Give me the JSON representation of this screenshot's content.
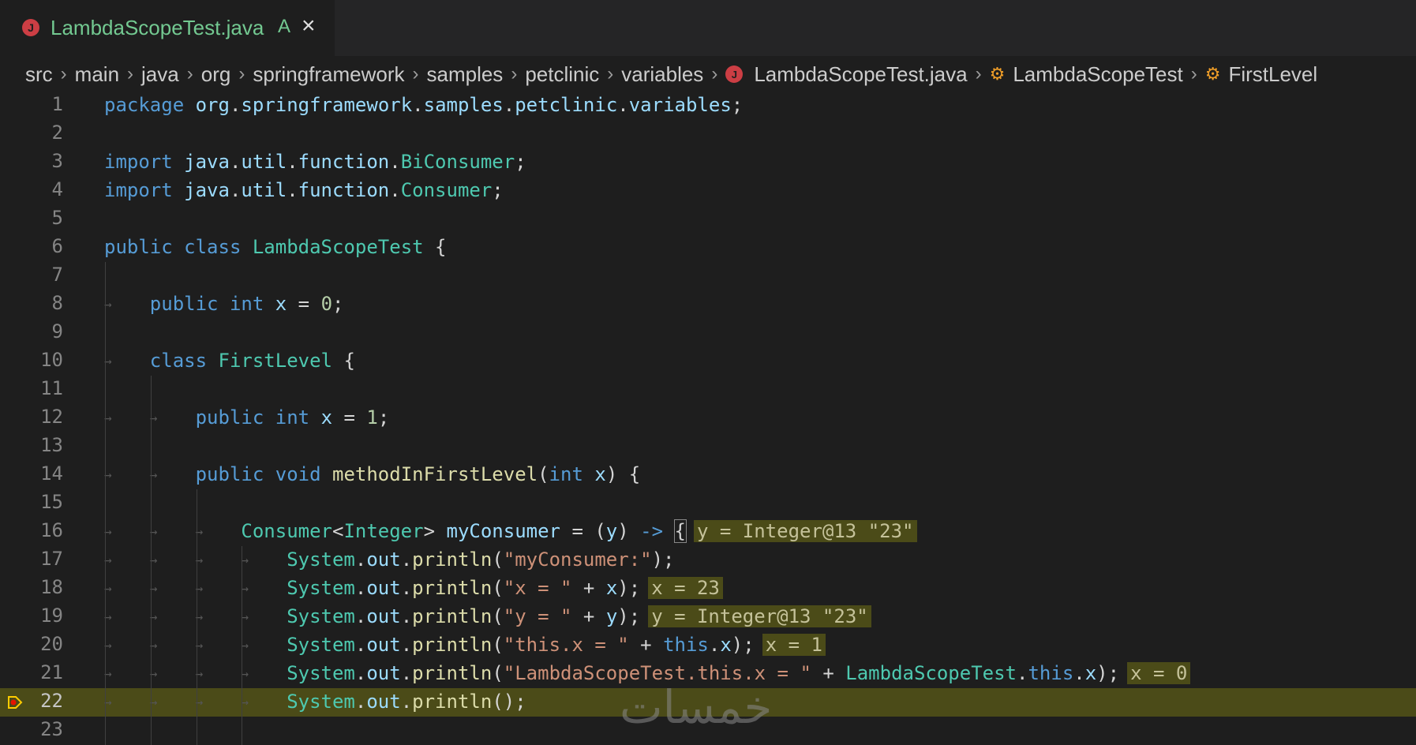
{
  "tab": {
    "title": "LambdaScopeTest.java",
    "badge": "A",
    "close_icon": "close-icon"
  },
  "breadcrumb": [
    "src",
    "main",
    "java",
    "org",
    "springframework",
    "samples",
    "petclinic",
    "variables",
    "LambdaScopeTest.java",
    "LambdaScopeTest",
    "FirstLevel"
  ],
  "current_line": 22,
  "colors": {
    "keyword": "#569cd6",
    "type": "#4ec9b0",
    "function": "#dcdcaa",
    "variable": "#9cdcfe",
    "string": "#ce9178",
    "number": "#b5cea8",
    "current_line_bg": "#4b4b18"
  },
  "lines": [
    {
      "n": "1",
      "tokens": [
        [
          "kw",
          "package"
        ],
        [
          "pl",
          " "
        ],
        [
          "vr",
          "org"
        ],
        [
          "pl",
          "."
        ],
        [
          "vr",
          "springframework"
        ],
        [
          "pl",
          "."
        ],
        [
          "vr",
          "samples"
        ],
        [
          "pl",
          "."
        ],
        [
          "vr",
          "petclinic"
        ],
        [
          "pl",
          "."
        ],
        [
          "vr",
          "variables"
        ],
        [
          "pl",
          ";"
        ]
      ]
    },
    {
      "n": "2",
      "tokens": []
    },
    {
      "n": "3",
      "tokens": [
        [
          "kw",
          "import"
        ],
        [
          "pl",
          " "
        ],
        [
          "vr",
          "java"
        ],
        [
          "pl",
          "."
        ],
        [
          "vr",
          "util"
        ],
        [
          "pl",
          "."
        ],
        [
          "vr",
          "function"
        ],
        [
          "pl",
          "."
        ],
        [
          "ty",
          "BiConsumer"
        ],
        [
          "pl",
          ";"
        ]
      ]
    },
    {
      "n": "4",
      "tokens": [
        [
          "kw",
          "import"
        ],
        [
          "pl",
          " "
        ],
        [
          "vr",
          "java"
        ],
        [
          "pl",
          "."
        ],
        [
          "vr",
          "util"
        ],
        [
          "pl",
          "."
        ],
        [
          "vr",
          "function"
        ],
        [
          "pl",
          "."
        ],
        [
          "ty",
          "Consumer"
        ],
        [
          "pl",
          ";"
        ]
      ]
    },
    {
      "n": "5",
      "tokens": []
    },
    {
      "n": "6",
      "tokens": [
        [
          "kw",
          "public"
        ],
        [
          "pl",
          " "
        ],
        [
          "kw",
          "class"
        ],
        [
          "pl",
          " "
        ],
        [
          "ty",
          "LambdaScopeTest"
        ],
        [
          "pl",
          " {"
        ]
      ]
    },
    {
      "n": "7",
      "tokens": []
    },
    {
      "n": "8",
      "tokens": [
        [
          "pl",
          "    "
        ],
        [
          "kw",
          "public"
        ],
        [
          "pl",
          " "
        ],
        [
          "kw",
          "int"
        ],
        [
          "pl",
          " "
        ],
        [
          "vr",
          "x"
        ],
        [
          "pl",
          " = "
        ],
        [
          "nm",
          "0"
        ],
        [
          "pl",
          ";"
        ]
      ]
    },
    {
      "n": "9",
      "tokens": []
    },
    {
      "n": "10",
      "tokens": [
        [
          "pl",
          "    "
        ],
        [
          "kw",
          "class"
        ],
        [
          "pl",
          " "
        ],
        [
          "ty",
          "FirstLevel"
        ],
        [
          "pl",
          " {"
        ]
      ]
    },
    {
      "n": "11",
      "tokens": []
    },
    {
      "n": "12",
      "tokens": [
        [
          "pl",
          "        "
        ],
        [
          "kw",
          "public"
        ],
        [
          "pl",
          " "
        ],
        [
          "kw",
          "int"
        ],
        [
          "pl",
          " "
        ],
        [
          "vr",
          "x"
        ],
        [
          "pl",
          " = "
        ],
        [
          "nm",
          "1"
        ],
        [
          "pl",
          ";"
        ]
      ]
    },
    {
      "n": "13",
      "tokens": []
    },
    {
      "n": "14",
      "tokens": [
        [
          "pl",
          "        "
        ],
        [
          "kw",
          "public"
        ],
        [
          "pl",
          " "
        ],
        [
          "kw",
          "void"
        ],
        [
          "pl",
          " "
        ],
        [
          "fn",
          "methodInFirstLevel"
        ],
        [
          "pl",
          "("
        ],
        [
          "kw",
          "int"
        ],
        [
          "pl",
          " "
        ],
        [
          "vr",
          "x"
        ],
        [
          "pl",
          ") {"
        ]
      ]
    },
    {
      "n": "15",
      "tokens": []
    },
    {
      "n": "16",
      "tokens": [
        [
          "pl",
          "            "
        ],
        [
          "ty",
          "Consumer"
        ],
        [
          "pl",
          "<"
        ],
        [
          "ty",
          "Integer"
        ],
        [
          "pl",
          "> "
        ],
        [
          "vr",
          "myConsumer"
        ],
        [
          "pl",
          " = ("
        ],
        [
          "vr",
          "y"
        ],
        [
          "pl",
          ") "
        ],
        [
          "kw",
          "->"
        ],
        [
          "pl",
          " "
        ],
        [
          "brace",
          "{"
        ]
      ],
      "inlay": "y = Integer@13 \"23\""
    },
    {
      "n": "17",
      "tokens": [
        [
          "pl",
          "                "
        ],
        [
          "ty",
          "System"
        ],
        [
          "pl",
          "."
        ],
        [
          "vr",
          "out"
        ],
        [
          "pl",
          "."
        ],
        [
          "fn",
          "println"
        ],
        [
          "pl",
          "("
        ],
        [
          "st",
          "\"myConsumer:\""
        ],
        [
          "pl",
          ");"
        ]
      ]
    },
    {
      "n": "18",
      "tokens": [
        [
          "pl",
          "                "
        ],
        [
          "ty",
          "System"
        ],
        [
          "pl",
          "."
        ],
        [
          "vr",
          "out"
        ],
        [
          "pl",
          "."
        ],
        [
          "fn",
          "println"
        ],
        [
          "pl",
          "("
        ],
        [
          "st",
          "\"x = \""
        ],
        [
          "pl",
          " + "
        ],
        [
          "vr",
          "x"
        ],
        [
          "pl",
          ");"
        ]
      ],
      "inlay": "x = 23"
    },
    {
      "n": "19",
      "tokens": [
        [
          "pl",
          "                "
        ],
        [
          "ty",
          "System"
        ],
        [
          "pl",
          "."
        ],
        [
          "vr",
          "out"
        ],
        [
          "pl",
          "."
        ],
        [
          "fn",
          "println"
        ],
        [
          "pl",
          "("
        ],
        [
          "st",
          "\"y = \""
        ],
        [
          "pl",
          " + "
        ],
        [
          "vr",
          "y"
        ],
        [
          "pl",
          ");"
        ]
      ],
      "inlay": "y = Integer@13 \"23\""
    },
    {
      "n": "20",
      "tokens": [
        [
          "pl",
          "                "
        ],
        [
          "ty",
          "System"
        ],
        [
          "pl",
          "."
        ],
        [
          "vr",
          "out"
        ],
        [
          "pl",
          "."
        ],
        [
          "fn",
          "println"
        ],
        [
          "pl",
          "("
        ],
        [
          "st",
          "\"this.x = \""
        ],
        [
          "pl",
          " + "
        ],
        [
          "kw",
          "this"
        ],
        [
          "pl",
          "."
        ],
        [
          "vr",
          "x"
        ],
        [
          "pl",
          ");"
        ]
      ],
      "inlay": "x = 1"
    },
    {
      "n": "21",
      "tokens": [
        [
          "pl",
          "                "
        ],
        [
          "ty",
          "System"
        ],
        [
          "pl",
          "."
        ],
        [
          "vr",
          "out"
        ],
        [
          "pl",
          "."
        ],
        [
          "fn",
          "println"
        ],
        [
          "pl",
          "("
        ],
        [
          "st",
          "\"LambdaScopeTest.this.x = \""
        ],
        [
          "pl",
          " + "
        ],
        [
          "ty",
          "LambdaScopeTest"
        ],
        [
          "pl",
          "."
        ],
        [
          "kw",
          "this"
        ],
        [
          "pl",
          "."
        ],
        [
          "vr",
          "x"
        ],
        [
          "pl",
          ");"
        ]
      ],
      "inlay": "x = 0"
    },
    {
      "n": "22",
      "tokens": [
        [
          "pl",
          "                "
        ],
        [
          "ty",
          "System"
        ],
        [
          "pl",
          "."
        ],
        [
          "vr",
          "out"
        ],
        [
          "pl",
          "."
        ],
        [
          "fn",
          "println"
        ],
        [
          "pl",
          "();"
        ]
      ]
    },
    {
      "n": "23",
      "tokens": []
    }
  ],
  "watermark": "خمسات"
}
